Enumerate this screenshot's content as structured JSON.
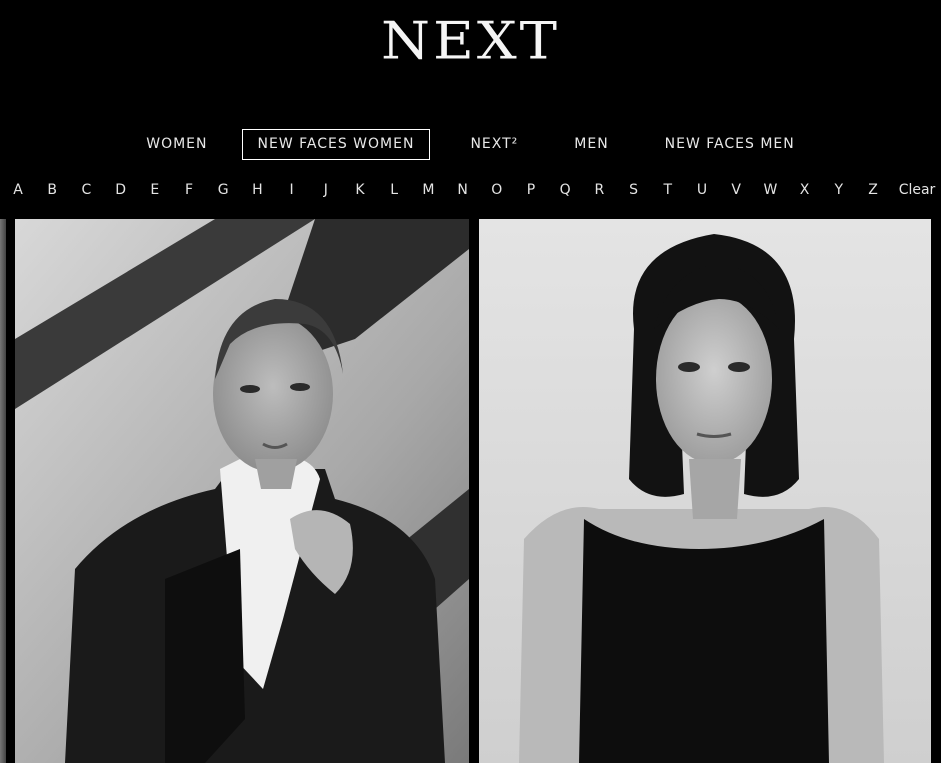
{
  "brand": {
    "logo": "NEXT"
  },
  "main_nav": {
    "items": [
      {
        "label": "WOMEN",
        "active": false
      },
      {
        "label": "NEW FACES WOMEN",
        "active": true
      },
      {
        "label": "NEXT²",
        "active": false
      },
      {
        "label": "MEN",
        "active": false
      },
      {
        "label": "NEW FACES MEN",
        "active": false
      }
    ]
  },
  "alpha_nav": {
    "letters": [
      "A",
      "B",
      "C",
      "D",
      "E",
      "F",
      "G",
      "H",
      "I",
      "J",
      "K",
      "L",
      "M",
      "N",
      "O",
      "P",
      "Q",
      "R",
      "S",
      "T",
      "U",
      "V",
      "W",
      "X",
      "Y",
      "Z"
    ],
    "clear_label": "Clear"
  },
  "gallery": {
    "tiles": [
      {
        "kind": "model-photo",
        "style": "black-and-white",
        "subject": "model in dark blazer and white shirt"
      },
      {
        "kind": "model-photo",
        "style": "black-and-white",
        "subject": "model in black sleeveless top"
      }
    ]
  },
  "colors": {
    "background": "#000000",
    "text": "#e6e6e6",
    "active_border": "#ffffff"
  }
}
